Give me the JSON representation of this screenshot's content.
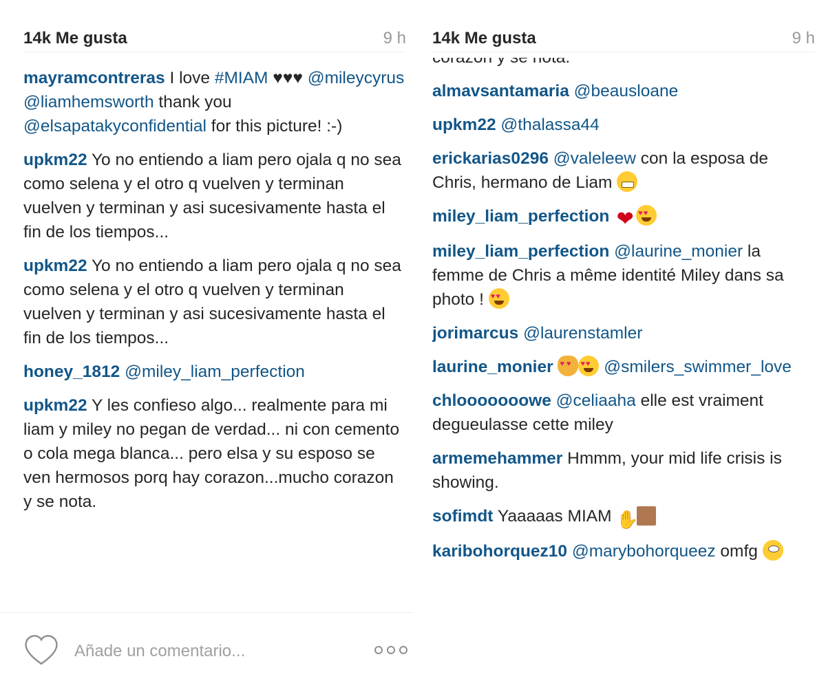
{
  "left": {
    "likes": "14k Me gusta",
    "time": "9 h",
    "comments": [
      {
        "user": "mayramcontreras",
        "parts": [
          {
            "t": "text",
            "v": " I love "
          },
          {
            "t": "tag",
            "v": "#MIAM"
          },
          {
            "t": "text",
            "v": " ♥♥♥ "
          },
          {
            "t": "mention",
            "v": "@mileycyrus"
          },
          {
            "t": "text",
            "v": " "
          },
          {
            "t": "mention",
            "v": "@liamhemsworth"
          },
          {
            "t": "text",
            "v": " thank you "
          },
          {
            "t": "mention",
            "v": "@elsapatakyconfidential"
          },
          {
            "t": "text",
            "v": " for this picture! :-)"
          }
        ]
      },
      {
        "user": "upkm22",
        "parts": [
          {
            "t": "text",
            "v": " Yo no entiendo a liam pero ojala q no sea como selena y el otro q vuelven y terminan vuelven y terminan y asi sucesivamente hasta el fin de los tiempos..."
          }
        ]
      },
      {
        "user": "upkm22",
        "parts": [
          {
            "t": "text",
            "v": " Yo no entiendo a liam pero ojala q no sea como selena y el otro q vuelven y terminan vuelven y terminan y asi sucesivamente hasta el fin de los tiempos..."
          }
        ]
      },
      {
        "user": "honey_1812",
        "parts": [
          {
            "t": "text",
            "v": " "
          },
          {
            "t": "mention",
            "v": "@miley_liam_perfection"
          }
        ]
      },
      {
        "user": "upkm22",
        "parts": [
          {
            "t": "text",
            "v": " Y les confieso algo... realmente para mi liam y miley no pegan de verdad... ni con cemento o cola mega blanca... pero elsa y su esposo se ven hermosos porq hay corazon...mucho corazon y se nota."
          }
        ]
      }
    ]
  },
  "right": {
    "likes": "14k Me gusta",
    "time": "9 h",
    "partial_top": "corazon y se nota.",
    "comments": [
      {
        "user": "almavsantamaria",
        "parts": [
          {
            "t": "text",
            "v": " "
          },
          {
            "t": "mention",
            "v": "@beausloane"
          }
        ]
      },
      {
        "user": "upkm22",
        "parts": [
          {
            "t": "text",
            "v": " "
          },
          {
            "t": "mention",
            "v": "@thalassa44"
          }
        ]
      },
      {
        "user": "erickarias0296",
        "parts": [
          {
            "t": "text",
            "v": " "
          },
          {
            "t": "mention",
            "v": "@valeleew"
          },
          {
            "t": "text",
            "v": " con la esposa de Chris, hermano de Liam "
          },
          {
            "t": "emoji",
            "v": "grin"
          }
        ]
      },
      {
        "user": "miley_liam_perfection",
        "parts": [
          {
            "t": "text",
            "v": " "
          },
          {
            "t": "emoji",
            "v": "red-heart"
          },
          {
            "t": "emoji",
            "v": "heart-eyes"
          }
        ]
      },
      {
        "user": "miley_liam_perfection",
        "parts": [
          {
            "t": "text",
            "v": " "
          },
          {
            "t": "mention",
            "v": "@laurine_monier"
          },
          {
            "t": "text",
            "v": " la femme de Chris a même identité Miley dans sa photo ! "
          },
          {
            "t": "emoji",
            "v": "heart-eyes"
          }
        ]
      },
      {
        "user": "jorimarcus",
        "parts": [
          {
            "t": "text",
            "v": " "
          },
          {
            "t": "mention",
            "v": "@laurenstamler"
          }
        ]
      },
      {
        "user": "laurine_monier",
        "parts": [
          {
            "t": "text",
            "v": " "
          },
          {
            "t": "emoji",
            "v": "cat"
          },
          {
            "t": "emoji",
            "v": "heart-eyes"
          },
          {
            "t": "text",
            "v": " "
          },
          {
            "t": "mention",
            "v": "@smilers_swimmer_love"
          }
        ]
      },
      {
        "user": "chlooooooowe",
        "parts": [
          {
            "t": "text",
            "v": " "
          },
          {
            "t": "mention",
            "v": "@celiaaha"
          },
          {
            "t": "text",
            "v": " elle est vraiment degueulasse cette miley"
          }
        ]
      },
      {
        "user": "armemehammer",
        "parts": [
          {
            "t": "text",
            "v": " Hmmm, your mid life crisis is showing."
          }
        ]
      },
      {
        "user": "sofimdt",
        "parts": [
          {
            "t": "text",
            "v": " Yaaaaas MIAM "
          },
          {
            "t": "emoji",
            "v": "hands"
          },
          {
            "t": "emoji",
            "v": "skin"
          }
        ]
      },
      {
        "user": "karibohorquez10",
        "parts": [
          {
            "t": "text",
            "v": " "
          },
          {
            "t": "mention",
            "v": "@marybohorqueez"
          },
          {
            "t": "text",
            "v": " omfg "
          },
          {
            "t": "emoji",
            "v": "worried"
          }
        ]
      }
    ]
  },
  "composer": {
    "placeholder": "Añade un comentario...",
    "like_icon": "heart-outline-icon",
    "more_icon": "more-options-icon"
  },
  "colors": {
    "username": "#125688",
    "text": "#262626",
    "muted": "#999999",
    "placeholder": "#a0a0a0"
  }
}
